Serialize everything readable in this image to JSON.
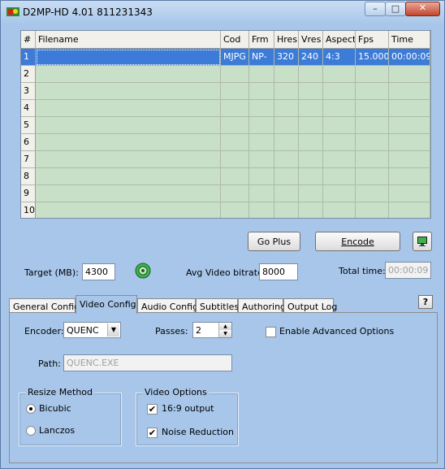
{
  "window": {
    "title": "D2MP-HD 4.01 811231343",
    "min_glyph": "–",
    "max_glyph": "□",
    "close_glyph": "✕"
  },
  "grid": {
    "columns": [
      "#",
      "Filename",
      "Cod",
      "Frm",
      "Hres",
      "Vres",
      "Aspect",
      "Fps",
      "Time"
    ],
    "rows": [
      [
        "1",
        "",
        "MJPG",
        "NP-",
        "320",
        "240",
        "4:3",
        "15.000",
        "00:00:09"
      ],
      [
        "2",
        "",
        "",
        "",
        "",
        "",
        "",
        "",
        ""
      ],
      [
        "3",
        "",
        "",
        "",
        "",
        "",
        "",
        "",
        ""
      ],
      [
        "4",
        "",
        "",
        "",
        "",
        "",
        "",
        "",
        ""
      ],
      [
        "5",
        "",
        "",
        "",
        "",
        "",
        "",
        "",
        ""
      ],
      [
        "6",
        "",
        "",
        "",
        "",
        "",
        "",
        "",
        ""
      ],
      [
        "7",
        "",
        "",
        "",
        "",
        "",
        "",
        "",
        ""
      ],
      [
        "8",
        "",
        "",
        "",
        "",
        "",
        "",
        "",
        ""
      ],
      [
        "9",
        "",
        "",
        "",
        "",
        "",
        "",
        "",
        ""
      ],
      [
        "10",
        "",
        "",
        "",
        "",
        "",
        "",
        "",
        ""
      ]
    ],
    "selected_row": 0
  },
  "buttons": {
    "go_plus": "Go Plus",
    "encode": "Encode"
  },
  "target": {
    "label": "Target (MB):",
    "value": "4300"
  },
  "bitrate": {
    "label": "Avg Video bitrate:",
    "value": "8000"
  },
  "total_time": {
    "label": "Total time:",
    "value": "00:00:09"
  },
  "tabs": [
    "General Config",
    "Video Config",
    "Audio Config",
    "Subtitles",
    "Authoring",
    "Output Log"
  ],
  "active_tab": "Video Config",
  "help_label": "?",
  "video_config": {
    "encoder_label": "Encoder:",
    "encoder_value": "QUENC",
    "passes_label": "Passes:",
    "passes_value": "2",
    "advanced_label": "Enable Advanced Options",
    "advanced_checked": false,
    "path_label": "Path:",
    "path_value": "QUENC.EXE",
    "resize_title": "Resize Method",
    "resize_options": [
      "Bicubic",
      "Lanczos"
    ],
    "resize_selected": "Bicubic",
    "video_options_title": "Video Options",
    "opt_169": "16:9 output",
    "opt_169_checked": true,
    "opt_noise": "Noise Reduction",
    "opt_noise_checked": true
  },
  "colors": {
    "window_bg": "#a7c6ea",
    "grid_bg": "#c8e0c8",
    "selection": "#3c7bd8"
  }
}
